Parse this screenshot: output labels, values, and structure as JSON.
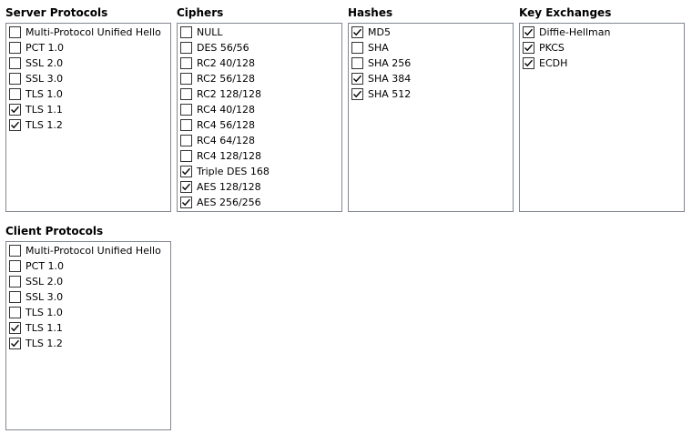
{
  "groups": {
    "server_protocols": {
      "title": "Server Protocols",
      "items": [
        {
          "label": "Multi-Protocol Unified Hello",
          "checked": false
        },
        {
          "label": "PCT 1.0",
          "checked": false
        },
        {
          "label": "SSL 2.0",
          "checked": false
        },
        {
          "label": "SSL 3.0",
          "checked": false
        },
        {
          "label": "TLS 1.0",
          "checked": false
        },
        {
          "label": "TLS 1.1",
          "checked": true
        },
        {
          "label": "TLS 1.2",
          "checked": true
        }
      ]
    },
    "ciphers": {
      "title": "Ciphers",
      "items": [
        {
          "label": "NULL",
          "checked": false
        },
        {
          "label": "DES 56/56",
          "checked": false
        },
        {
          "label": "RC2 40/128",
          "checked": false
        },
        {
          "label": "RC2 56/128",
          "checked": false
        },
        {
          "label": "RC2 128/128",
          "checked": false
        },
        {
          "label": "RC4 40/128",
          "checked": false
        },
        {
          "label": "RC4 56/128",
          "checked": false
        },
        {
          "label": "RC4 64/128",
          "checked": false
        },
        {
          "label": "RC4 128/128",
          "checked": false
        },
        {
          "label": "Triple DES 168",
          "checked": true
        },
        {
          "label": "AES 128/128",
          "checked": true
        },
        {
          "label": "AES 256/256",
          "checked": true
        }
      ]
    },
    "hashes": {
      "title": "Hashes",
      "items": [
        {
          "label": "MD5",
          "checked": true
        },
        {
          "label": "SHA",
          "checked": false
        },
        {
          "label": "SHA 256",
          "checked": false
        },
        {
          "label": "SHA 384",
          "checked": true
        },
        {
          "label": "SHA 512",
          "checked": true
        }
      ]
    },
    "key_exchanges": {
      "title": "Key Exchanges",
      "items": [
        {
          "label": "Diffie-Hellman",
          "checked": true
        },
        {
          "label": "PKCS",
          "checked": true
        },
        {
          "label": "ECDH",
          "checked": true
        }
      ]
    },
    "client_protocols": {
      "title": "Client Protocols",
      "items": [
        {
          "label": "Multi-Protocol Unified Hello",
          "checked": false
        },
        {
          "label": "PCT 1.0",
          "checked": false
        },
        {
          "label": "SSL 2.0",
          "checked": false
        },
        {
          "label": "SSL 3.0",
          "checked": false
        },
        {
          "label": "TLS 1.0",
          "checked": false
        },
        {
          "label": "TLS 1.1",
          "checked": true
        },
        {
          "label": "TLS 1.2",
          "checked": true
        }
      ]
    }
  },
  "icons": {
    "checkmark": "checkmark-icon"
  },
  "colors": {
    "border": "#828790",
    "checkbox_border": "#333333",
    "check": "#000000",
    "background": "#ffffff"
  }
}
